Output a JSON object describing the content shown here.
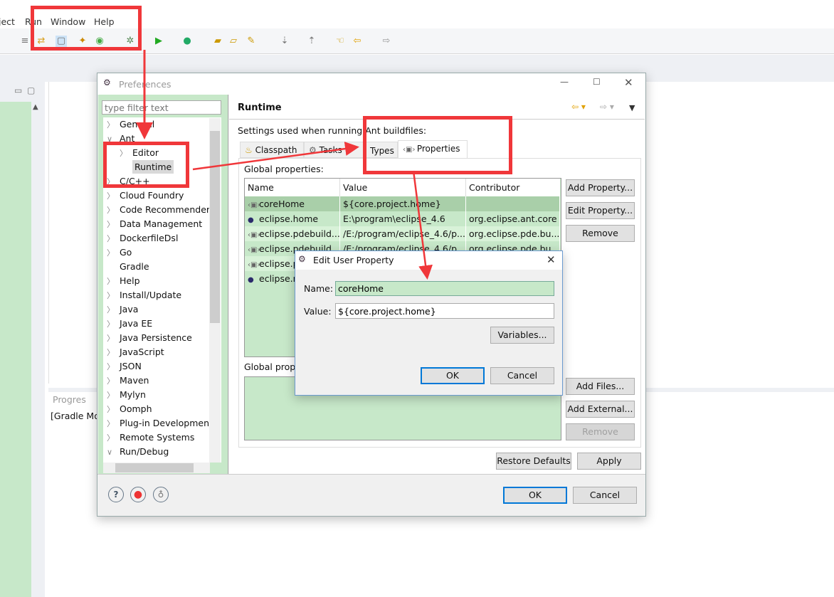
{
  "menubar": {
    "items": [
      "ject",
      "Run",
      "Window",
      "Help"
    ]
  },
  "preferences": {
    "title": "Preferences",
    "filter_placeholder": "type filter text",
    "tree": [
      {
        "label": "General",
        "state": "collapsed",
        "level": 0
      },
      {
        "label": "Ant",
        "state": "expanded",
        "level": 0
      },
      {
        "label": "Editor",
        "state": "collapsed",
        "level": 1
      },
      {
        "label": "Runtime",
        "state": "leaf",
        "level": 1,
        "selected": true
      },
      {
        "label": "C/C++",
        "state": "collapsed",
        "level": 0
      },
      {
        "label": "Cloud Foundry",
        "state": "collapsed",
        "level": 0
      },
      {
        "label": "Code Recommenders",
        "state": "collapsed",
        "level": 0
      },
      {
        "label": "Data Management",
        "state": "collapsed",
        "level": 0
      },
      {
        "label": "DockerfileDsl",
        "state": "collapsed",
        "level": 0
      },
      {
        "label": "Go",
        "state": "collapsed",
        "level": 0
      },
      {
        "label": "Gradle",
        "state": "leaf",
        "level": 0
      },
      {
        "label": "Help",
        "state": "collapsed",
        "level": 0
      },
      {
        "label": "Install/Update",
        "state": "collapsed",
        "level": 0
      },
      {
        "label": "Java",
        "state": "collapsed",
        "level": 0
      },
      {
        "label": "Java EE",
        "state": "collapsed",
        "level": 0
      },
      {
        "label": "Java Persistence",
        "state": "collapsed",
        "level": 0
      },
      {
        "label": "JavaScript",
        "state": "collapsed",
        "level": 0
      },
      {
        "label": "JSON",
        "state": "collapsed",
        "level": 0
      },
      {
        "label": "Maven",
        "state": "collapsed",
        "level": 0
      },
      {
        "label": "Mylyn",
        "state": "collapsed",
        "level": 0
      },
      {
        "label": "Oomph",
        "state": "collapsed",
        "level": 0
      },
      {
        "label": "Plug-in Development",
        "state": "collapsed",
        "level": 0
      },
      {
        "label": "Remote Systems",
        "state": "collapsed",
        "level": 0
      },
      {
        "label": "Run/Debug",
        "state": "expanded",
        "level": 0
      }
    ],
    "page_title": "Runtime",
    "description": "Settings used when running Ant buildfiles:",
    "tabs": [
      "Classpath",
      "Tasks",
      "Types",
      "Properties"
    ],
    "active_tab": "Properties",
    "global_properties_label": "Global properties:",
    "columns": [
      "Name",
      "Value",
      "Contributor"
    ],
    "rows": [
      {
        "name": "coreHome",
        "value": "${core.project.home}",
        "contributor": "",
        "icon": "property-icon",
        "selected": true
      },
      {
        "name": "eclipse.home",
        "value": "E:\\program\\eclipse_4.6",
        "contributor": "org.eclipse.ant.core",
        "icon": "eclipse-icon"
      },
      {
        "name": "eclipse.pdebuild....",
        "value": "/E:/program/eclipse_4.6/p...",
        "contributor": "org.eclipse.pde.bu...",
        "icon": "property-icon"
      },
      {
        "name": "eclipse.pdebuild....",
        "value": "/E:/program/eclipse_4.6/p...",
        "contributor": "org.eclipse.pde.bu...",
        "icon": "property-icon"
      },
      {
        "name": "eclipse.p...",
        "value": "",
        "contributor": "",
        "icon": "property-icon"
      },
      {
        "name": "eclipse.r...",
        "value": "",
        "contributor": "",
        "icon": "eclipse-icon"
      }
    ],
    "prop_buttons": {
      "add": "Add Property...",
      "edit": "Edit Property...",
      "remove": "Remove"
    },
    "files_label": "Global prop",
    "file_buttons": {
      "add_files": "Add Files...",
      "add_external": "Add External...",
      "remove": "Remove"
    },
    "restore_defaults": "Restore Defaults",
    "apply": "Apply",
    "ok": "OK",
    "cancel": "Cancel"
  },
  "edit_dialog": {
    "title": "Edit User Property",
    "name_label": "Name:",
    "name_value": "coreHome",
    "value_label": "Value:",
    "value_value": "${core.project.home}",
    "variables": "Variables...",
    "ok": "OK",
    "cancel": "Cancel"
  },
  "background": {
    "progress_tab": "Progres",
    "progress_item": "[Gradle Mo"
  },
  "colors": {
    "annotation": "#f0373a",
    "green_bg": "#c7e8c9",
    "selected_row": "#a9cfa9",
    "focus": "#0078d7"
  }
}
